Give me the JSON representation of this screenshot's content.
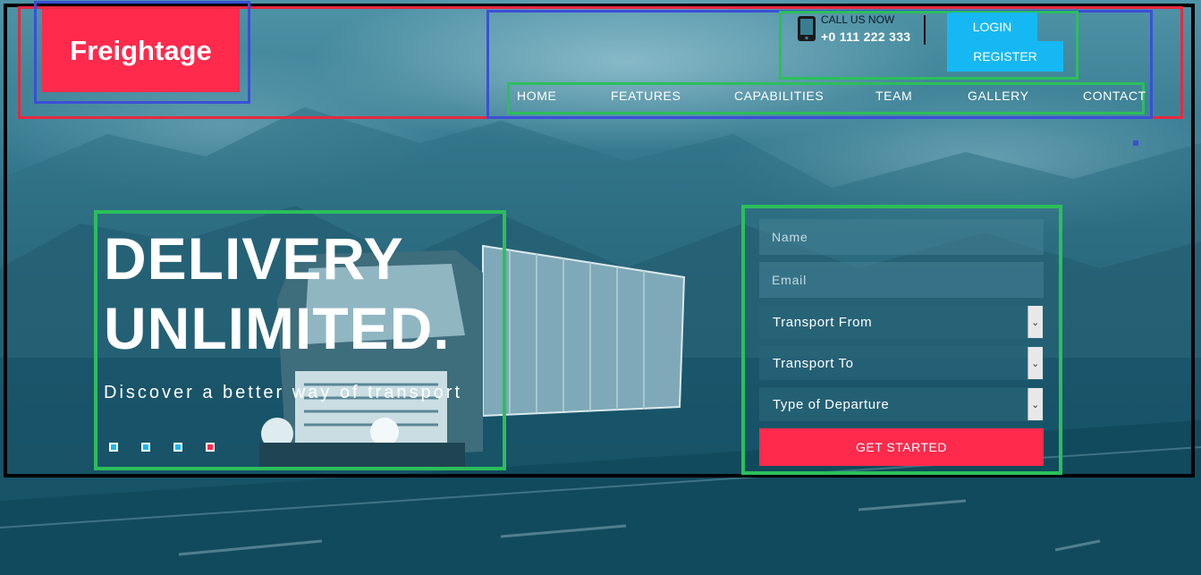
{
  "brand": {
    "logo_text": "Freightage",
    "accent": "#ff2a4c",
    "secondary": "#16b8f3"
  },
  "contact": {
    "icon": "mobile-phone-icon",
    "label": "CALL US NOW",
    "number": "+0 111 222 333"
  },
  "auth": {
    "login_label": "LOGIN",
    "register_label": "REGISTER"
  },
  "nav": {
    "items": [
      "HOME",
      "FEATURES",
      "CAPABILITIES",
      "TEAM",
      "GALLERY",
      "CONTACT"
    ]
  },
  "hero": {
    "title_line1": "DELIVERY",
    "title_line2": "UNLIMITED.",
    "subtitle": "Discover a better way of transport",
    "slides": {
      "count": 4,
      "active": 4
    }
  },
  "form": {
    "name_placeholder": "Name",
    "email_placeholder": "Email",
    "transport_from": "Transport From",
    "transport_to": "Transport To",
    "departure_type": "Type of Departure",
    "submit_label": "GET STARTED"
  }
}
